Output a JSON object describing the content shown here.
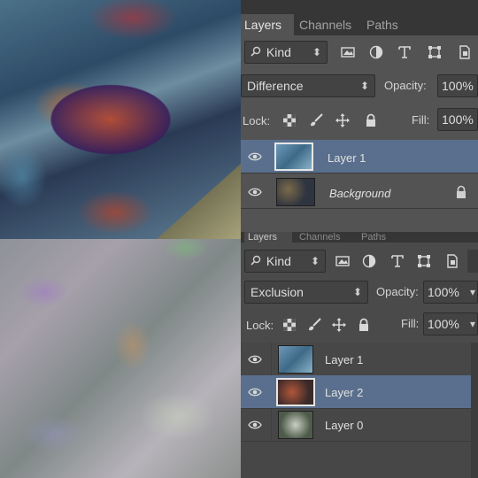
{
  "top_panel": {
    "tabs": [
      {
        "label": "Layers",
        "active": true
      },
      {
        "label": "Channels",
        "active": false
      },
      {
        "label": "Paths",
        "active": false
      }
    ],
    "filter": {
      "label": "Kind"
    },
    "blend_mode": "Difference",
    "opacity_label": "Opacity:",
    "opacity_value": "100%",
    "lock_label": "Lock:",
    "fill_label": "Fill:",
    "fill_value": "100%",
    "layers": [
      {
        "name": "Layer 1",
        "selected": true
      },
      {
        "name": "Background",
        "selected": false,
        "locked": true
      }
    ]
  },
  "bottom_panel": {
    "tabs": [
      {
        "label": "Layers",
        "active": true
      },
      {
        "label": "Channels",
        "active": false
      },
      {
        "label": "Paths",
        "active": false
      }
    ],
    "filter": {
      "label": "Kind"
    },
    "blend_mode": "Exclusion",
    "opacity_label": "Opacity:",
    "opacity_value": "100%",
    "lock_label": "Lock:",
    "fill_label": "Fill:",
    "fill_value": "100%",
    "layers": [
      {
        "name": "Layer 1",
        "selected": false
      },
      {
        "name": "Layer 2",
        "selected": true
      },
      {
        "name": "Layer 0",
        "selected": false
      }
    ]
  },
  "colors": {
    "panel_bg": "#535353",
    "selection": "#5a6f8d",
    "tabbar_bg": "#363636"
  }
}
